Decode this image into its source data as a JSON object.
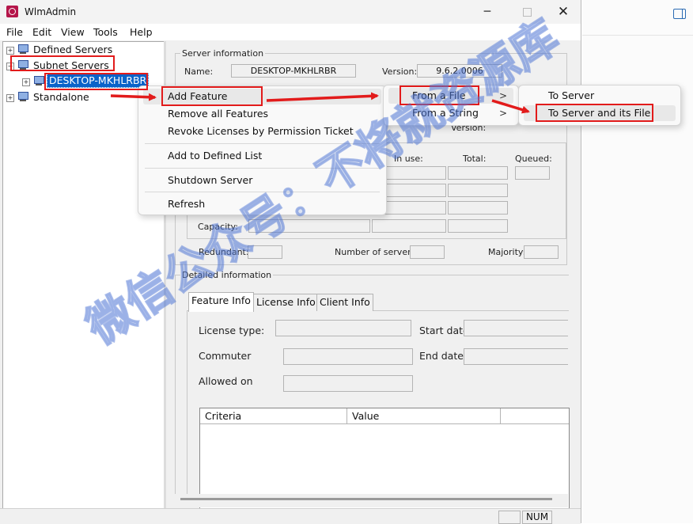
{
  "window": {
    "title": "WlmAdmin",
    "minimize_glyph": "─",
    "maximize_glyph": "",
    "close_glyph": "✕"
  },
  "menu": [
    "File",
    "Edit",
    "View",
    "Tools",
    "Help"
  ],
  "tree": {
    "defined_servers": "Defined Servers",
    "subnet_servers": "Subnet Servers",
    "selected_host": "DESKTOP-MKHLRBR",
    "standalone": "Standalone",
    "expander_plus": "+",
    "expander_minus": "−"
  },
  "server_info": {
    "group_label": "Server information",
    "name_label": "Name:",
    "name_value": "DESKTOP-MKHLRBR",
    "version_label": "Version:",
    "version_value": "9.6.2.0006",
    "version_label2": "Version:",
    "in_use_label": "In use:",
    "total_label": "Total:",
    "queued_label": "Queued:",
    "capacity_label": "Capacity:",
    "redundant_label": "Redundant:",
    "num_servers_label": "Number of servers:",
    "majority_label": "Majority:"
  },
  "detailed_info": {
    "group_label": "Detailed information",
    "tabs": [
      "Feature Info",
      "License Info",
      "Client Info"
    ],
    "license_type_label": "License type:",
    "start_date_label": "Start date",
    "commuter_label": "Commuter",
    "end_date_label": "End date:",
    "allowed_on_label": "Allowed on",
    "table_headers": [
      "Criteria",
      "Value"
    ]
  },
  "statusbar": {
    "num": "NUM"
  },
  "context_menu": {
    "items": [
      "Add Feature",
      "Remove all Features",
      "Revoke Licenses by Permission Ticket",
      "Add to Defined List",
      "Shutdown Server",
      "Refresh"
    ]
  },
  "submenu_1": {
    "items": [
      "From a File",
      "From a String"
    ],
    "chevron": ">"
  },
  "submenu_2": {
    "items": [
      "To Server",
      "To Server and its File"
    ]
  },
  "watermark": "微信公众号：不将就资源库",
  "colors": {
    "highlight_red": "#e21b1b",
    "selection_blue": "#0a63c9",
    "app_icon": "#b5164a"
  }
}
